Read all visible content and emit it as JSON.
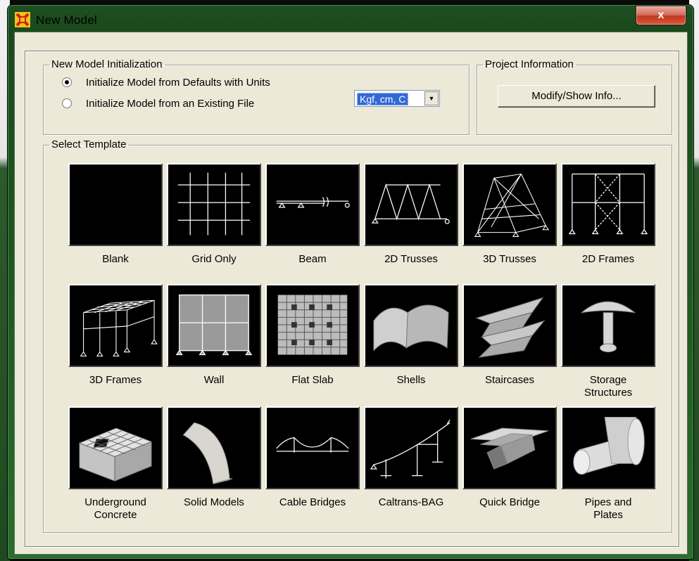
{
  "window": {
    "title": "New Model",
    "close_label": "x"
  },
  "init_group": {
    "legend": "New Model Initialization",
    "option_defaults": "Initialize Model from Defaults with Units",
    "option_existing": "Initialize Model  from an Existing File",
    "selected_option": "defaults",
    "units_value": "Kgf, cm, C"
  },
  "project_group": {
    "legend": "Project Information",
    "button_label": "Modify/Show Info..."
  },
  "template_group": {
    "legend": "Select Template",
    "templates": [
      {
        "label": "Blank",
        "icon": "blank-icon"
      },
      {
        "label": "Grid Only",
        "icon": "grid-icon"
      },
      {
        "label": "Beam",
        "icon": "beam-icon"
      },
      {
        "label": "2D Trusses",
        "icon": "2d-truss-icon"
      },
      {
        "label": "3D Trusses",
        "icon": "3d-truss-icon"
      },
      {
        "label": "2D Frames",
        "icon": "2d-frame-icon"
      },
      {
        "label": "3D Frames",
        "icon": "3d-frame-icon"
      },
      {
        "label": "Wall",
        "icon": "wall-icon"
      },
      {
        "label": "Flat Slab",
        "icon": "flat-slab-icon"
      },
      {
        "label": "Shells",
        "icon": "shells-icon"
      },
      {
        "label": "Staircases",
        "icon": "staircase-icon"
      },
      {
        "label": "Storage\nStructures",
        "icon": "storage-structure-icon"
      },
      {
        "label": "Underground\nConcrete",
        "icon": "underground-concrete-icon"
      },
      {
        "label": "Solid Models",
        "icon": "solid-model-icon"
      },
      {
        "label": "Cable Bridges",
        "icon": "cable-bridge-icon"
      },
      {
        "label": "Caltrans-BAG",
        "icon": "caltrans-bag-icon"
      },
      {
        "label": "Quick Bridge",
        "icon": "quick-bridge-icon"
      },
      {
        "label": "Pipes and\nPlates",
        "icon": "pipes-plates-icon"
      }
    ]
  },
  "colors": {
    "accent": "#3168d5",
    "window_frame": "#1d5a21",
    "dialog_bg": "#ece9d8"
  }
}
